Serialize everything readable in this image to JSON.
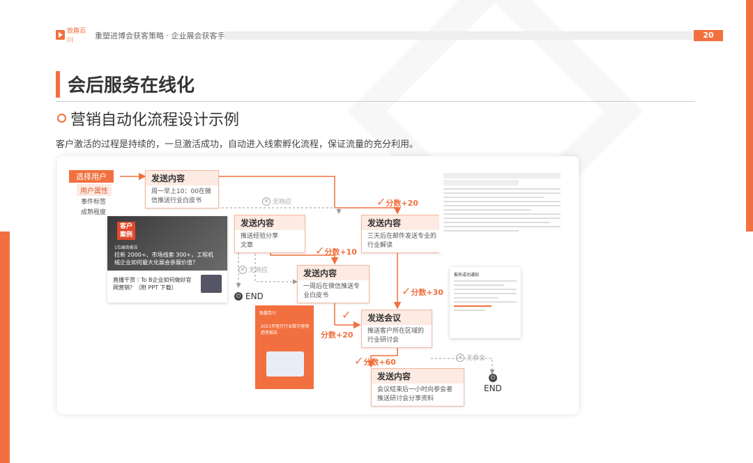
{
  "header": {
    "logo": "致趣百川",
    "title": "重塑进博会获客策略 · 企业展会获客手册",
    "page_number": "20"
  },
  "section": {
    "title": "会后服务在线化",
    "subtitle": "营销自动化流程设计示例",
    "description": "客户激活的过程是持续的，一旦激活成功，自动进入线索孵化流程，保证流量的充分利用。"
  },
  "flow": {
    "select_user": "选择用户",
    "side_labels": [
      "用户属性",
      "事件标签",
      "成熟程度"
    ],
    "nodes": [
      {
        "title": "发送内容",
        "body": "周一早上10：00在微信推送行业白皮书"
      },
      {
        "title": "发送内容",
        "body": "推送经验分享文章"
      },
      {
        "title": "发送内容",
        "body": "三天后在邮件发送专业的行业解读"
      },
      {
        "title": "发送内容",
        "body": "一周后在微信推送专业白皮书"
      },
      {
        "title": "发送会议",
        "body": "推送客户所在区域的行业研讨会"
      },
      {
        "title": "发送内容",
        "body": "会议结束后一小时向参会者推送研讨会分享资料"
      }
    ],
    "scores": [
      "分数+20",
      "分数+10",
      "分数+30",
      "分数+20",
      "分数+60"
    ],
    "no_response": [
      "无响应",
      "无响应"
    ],
    "not_attend": "无参会",
    "end_labels": [
      "END",
      "END"
    ]
  },
  "case_card": {
    "badge": "客户案例",
    "small_text": "1位展商报告",
    "headline": "拉新 2000+、市场线索 300+，工程机械企业如何最大化展会参展价值？",
    "footer": "直播干货｜To B企业如何做好官网营销？（附 PPT 下载）"
  },
  "report": {
    "logo": "致趣百川",
    "title": "2021年医疗行业数字营销趋势报告"
  },
  "popup": {
    "title": "报名成功通知"
  },
  "colors": {
    "accent": "#f2703f",
    "tag_bg": "#fdeae2"
  }
}
